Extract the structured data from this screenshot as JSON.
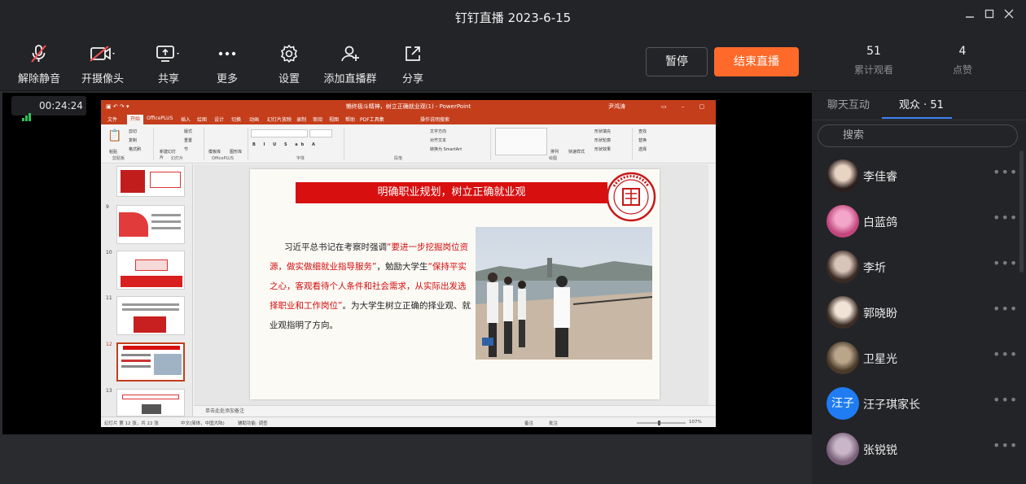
{
  "window": {
    "title": "钉钉直播 2023-6-15"
  },
  "toolbar": {
    "mute_label": "解除静音",
    "camera_label": "开摄像头",
    "share_label": "共享",
    "more_label": "更多",
    "settings_label": "设置",
    "add_group_label": "添加直播群",
    "shareout_label": "分享",
    "pause_label": "暂停",
    "end_label": "结束直播"
  },
  "stats": {
    "views_value": "51",
    "views_label": "累计观看",
    "likes_value": "4",
    "likes_label": "点赞"
  },
  "live": {
    "elapsed": "00:24:24"
  },
  "ppt": {
    "doc_title": "懒终极斗精神，树立正确就业观(1) - PowerPoint",
    "user": "尹鸿涛",
    "tabs": [
      "文件",
      "开始",
      "OfficePLUS",
      "插入",
      "绘图",
      "设计",
      "切换",
      "动画",
      "幻灯片放映",
      "录制",
      "审阅",
      "视图",
      "帮助",
      "PDF工具集",
      "操作说明搜索"
    ],
    "ribbon": {
      "clipboard": "剪贴板",
      "slides": "幻灯片",
      "officeplus": "OfficePLUS",
      "font": "字体",
      "paragraph": "段落",
      "drawing": "绘图",
      "paste": "粘贴",
      "cut": "剪切",
      "copy": "复制",
      "format_painter": "格式刷",
      "new_slide": "新建幻灯片",
      "layout": "版式",
      "reset": "重置",
      "section": "节",
      "template": "模板库",
      "graphics": "图形库",
      "text_dir": "文字方向",
      "align_text": "对齐文本",
      "smartart": "转换为 SmartArt",
      "arrange": "排列",
      "quick_styles": "快速样式",
      "fill": "形状填充",
      "outline": "形状轮廓",
      "effects": "形状效果",
      "find": "查找",
      "replace": "替换",
      "select": "选择"
    },
    "thumb_numbers": [
      "9",
      "10",
      "11",
      "12",
      "13"
    ],
    "slide": {
      "heading": "明确职业规划，树立正确就业观",
      "p1": "习近平总书记在考察时强调",
      "q1": "“要进一步挖掘岗位资源，做实做细就业指导服务”",
      "p2": "，勉励大学生",
      "q2": "“保持平实之心，客观看待个人条件和社会需求，从实际出发选择职业和工作岗位”",
      "p3": "。为大学生树立正确的择业观、就业观指明了方向。"
    },
    "notes_placeholder": "单击此处添加备注",
    "status": {
      "slide_pos": "幻灯片 第 12 张，共 22 张",
      "lang": "中文(简体，中国大陆)",
      "accessibility": "辅助功能: 调查",
      "notes": "备注",
      "comments": "批注",
      "zoom": "107%"
    }
  },
  "panel": {
    "tab_chat": "聊天互动",
    "tab_audience": "观众 · 51",
    "search_placeholder": "搜索",
    "members": [
      {
        "name": "李佳睿",
        "avatar": "photo"
      },
      {
        "name": "白蓝鸽",
        "avatar": "flower"
      },
      {
        "name": "李圻",
        "avatar": "photo"
      },
      {
        "name": "郭晓盼",
        "avatar": "photo"
      },
      {
        "name": "卫星光",
        "avatar": "photo"
      },
      {
        "name": "汪子琪家长",
        "avatar": "text",
        "avatar_text": "汪子"
      },
      {
        "name": "张锐锐",
        "avatar": "photo"
      }
    ]
  },
  "colors": {
    "accent_orange": "#ff6a2a",
    "tab_blue": "#3e82f7",
    "ppt_red": "#c43e1c",
    "slide_red": "#d80f0f"
  }
}
